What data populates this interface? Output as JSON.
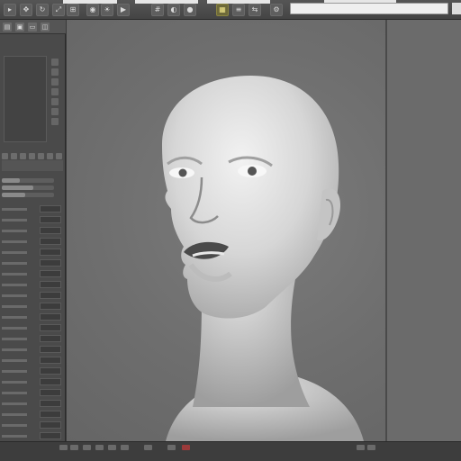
{
  "toolbar": {
    "buttons": [
      {
        "name": "select-tool-icon",
        "glyph": "▸"
      },
      {
        "name": "move-tool-icon",
        "glyph": "✥"
      },
      {
        "name": "rotate-tool-icon",
        "glyph": "↻"
      },
      {
        "name": "scale-tool-icon",
        "glyph": "⤢"
      },
      {
        "name": "snap-icon",
        "glyph": "⊞"
      },
      {
        "name": "camera-icon",
        "glyph": "◉"
      },
      {
        "name": "light-icon",
        "glyph": "☀"
      },
      {
        "name": "render-icon",
        "glyph": "▶"
      },
      {
        "name": "grid-icon",
        "glyph": "#"
      },
      {
        "name": "sculpt-icon",
        "glyph": "◐"
      },
      {
        "name": "material-icon",
        "glyph": "●"
      },
      {
        "name": "texture-icon",
        "glyph": "▦"
      },
      {
        "name": "layer-icon",
        "glyph": "≡"
      },
      {
        "name": "mirror-icon",
        "glyph": "⇆"
      },
      {
        "name": "settings-icon",
        "glyph": "⚙"
      }
    ]
  },
  "left_panel": {
    "header_icons": [
      {
        "name": "file-icon",
        "glyph": "▤"
      },
      {
        "name": "save-icon",
        "glyph": "▣"
      },
      {
        "name": "folder-icon",
        "glyph": "▭"
      },
      {
        "name": "view-icon",
        "glyph": "◫"
      }
    ]
  },
  "props": {
    "sliders": [
      0.35,
      0.6,
      0.45
    ]
  },
  "bottom": {
    "accent_color": "#9a3a3a"
  }
}
